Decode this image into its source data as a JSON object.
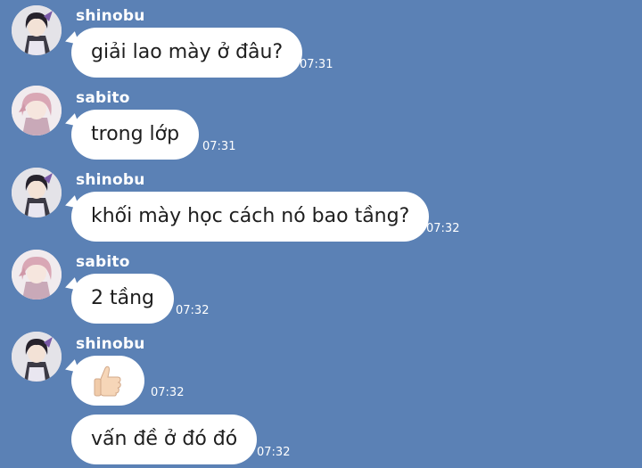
{
  "messages": [
    {
      "sender": "shinobu",
      "text": "giải lao mày ở đâu?",
      "time": "07:31"
    },
    {
      "sender": "sabito",
      "text": "trong lớp",
      "time": "07:31"
    },
    {
      "sender": "shinobu",
      "text": "khối mày học cách nó bao tầng?",
      "time": "07:32"
    },
    {
      "sender": "sabito",
      "text": "2 tầng",
      "time": "07:32"
    },
    {
      "sender": "shinobu",
      "text": "👍🏻",
      "time": "07:32"
    },
    {
      "sender": "",
      "text": "vấn đề ở đó đó",
      "time": "07:32"
    }
  ],
  "colors": {
    "background": "#5b81b5",
    "bubble": "#ffffff",
    "text": "#1e1e1e"
  }
}
